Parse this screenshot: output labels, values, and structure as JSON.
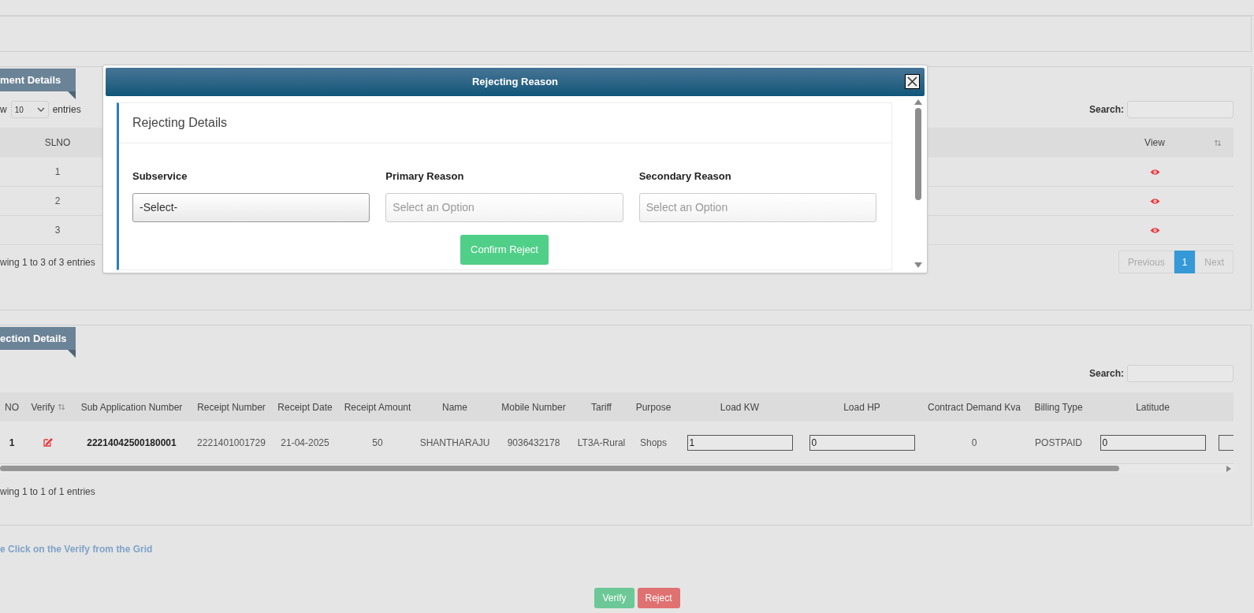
{
  "section_1": {
    "tab": "ment Details",
    "length": {
      "prefix": "w",
      "value": "10",
      "suffix": "entries"
    },
    "search": {
      "label": "Search:"
    },
    "columns": [
      "SLNO",
      "View"
    ],
    "rows": [
      {
        "slno": "1"
      },
      {
        "slno": "2"
      },
      {
        "slno": "3"
      }
    ],
    "info": "wing 1 to 3 of 3 entries",
    "pagination": [
      {
        "label": "Previous",
        "kind": "nav",
        "selected": false,
        "disabled": true
      },
      {
        "label": "1",
        "kind": "page",
        "selected": true,
        "disabled": false
      },
      {
        "label": "Next",
        "kind": "nav",
        "selected": false,
        "disabled": true
      }
    ]
  },
  "section_2": {
    "tab": "ection Details",
    "search": {
      "label": "Search:"
    },
    "columns": [
      "NO",
      "Verify",
      "Sub Application Number",
      "Receipt Number",
      "Receipt Date",
      "Receipt Amount",
      "Name",
      "Mobile Number",
      "Tariff",
      "Purpose",
      "Load KW",
      "Load HP",
      "Contract Demand Kva",
      "Billing Type",
      "Latitude"
    ],
    "row": [
      {
        "kind": "text",
        "value": "1",
        "bold": true
      },
      {
        "kind": "edit"
      },
      {
        "kind": "text",
        "value": "22214042500180001",
        "bold": true
      },
      {
        "kind": "text",
        "value": "2221401001729",
        "bold": false
      },
      {
        "kind": "text",
        "value": "21-04-2025",
        "bold": false
      },
      {
        "kind": "text",
        "value": "50",
        "bold": false
      },
      {
        "kind": "text",
        "value": "SHANTHARAJU",
        "bold": false
      },
      {
        "kind": "text",
        "value": "9036432178",
        "bold": false
      },
      {
        "kind": "text",
        "value": "LT3A-Rural",
        "bold": false
      },
      {
        "kind": "text",
        "value": "Shops",
        "bold": false
      },
      {
        "kind": "input",
        "value": "1"
      },
      {
        "kind": "input",
        "value": "0"
      },
      {
        "kind": "text",
        "value": "0",
        "bold": false
      },
      {
        "kind": "text",
        "value": "POSTPAID",
        "bold": false
      },
      {
        "kind": "input",
        "value": "0"
      }
    ],
    "info": "wing 1 to 1 of 1 entries"
  },
  "hint": "e Click on the Verify from the Grid",
  "actions": [
    {
      "label": "Verify",
      "kind": "verify"
    },
    {
      "label": "Reject",
      "kind": "reject"
    }
  ],
  "modal": {
    "title": "Rejecting Reason",
    "card_title": "Rejecting Details",
    "fields": [
      {
        "label": "Subservice",
        "value": "-Select-"
      },
      {
        "label": "Primary Reason",
        "placeholder": "Select an Option"
      },
      {
        "label": "Secondary Reason",
        "placeholder": "Select an Option"
      }
    ],
    "confirm": "Confirm Reject"
  }
}
